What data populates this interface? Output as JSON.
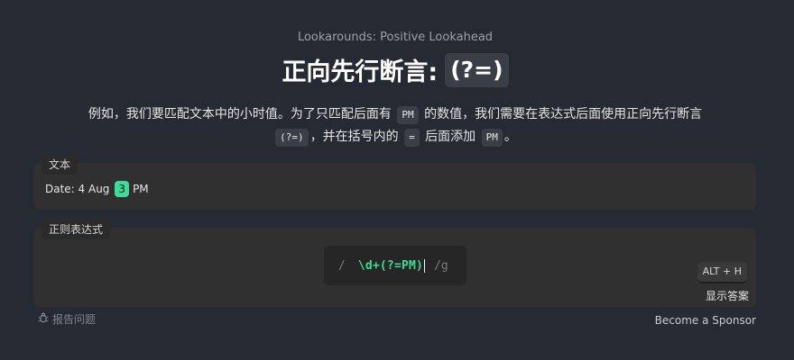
{
  "header": {
    "subtitle": "Lookarounds: Positive Lookahead",
    "title": "正向先行断言:",
    "title_code": "(?=)"
  },
  "description": {
    "part1": "例如，我们要匹配文本中的小时值。为了只匹配后面有",
    "code1": "PM",
    "part2": "的数值，我们需要在表达式后面使用正向先行断言",
    "code2": "(?=)",
    "part3": "，并在括号内的",
    "code3": "=",
    "part4": "后面添加",
    "code4": "PM",
    "part5": "。"
  },
  "text_panel": {
    "label": "文本",
    "before": "Date: 4 Aug",
    "match": "3",
    "after": "PM"
  },
  "regex_panel": {
    "label": "正则表达式",
    "open_slash": "/",
    "value": "\\d+(?=PM)",
    "flags": "/g",
    "shortcut": "ALT + H",
    "show_answer": "显示答案"
  },
  "footer": {
    "report": "报告问题",
    "sponsor": "Become a Sponsor"
  },
  "colors": {
    "background": "#262a33",
    "panel": "#303030",
    "match": "#3ddc97",
    "regex_text": "#3ddc97"
  }
}
